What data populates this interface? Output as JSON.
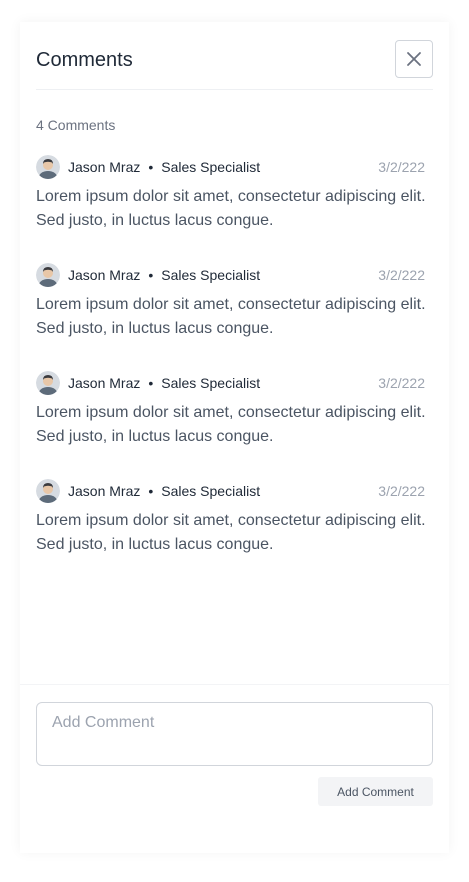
{
  "panel": {
    "title": "Comments",
    "close_icon": "close-icon"
  },
  "comments_count": "4 Comments",
  "comments": [
    {
      "author": "Jason Mraz",
      "separator": "•",
      "role": "Sales Specialist",
      "date": "3/2/222",
      "text": "Lorem ipsum dolor sit amet, consectetur adipiscing elit. Sed justo, in luctus lacus congue."
    },
    {
      "author": "Jason Mraz",
      "separator": "•",
      "role": "Sales Specialist",
      "date": "3/2/222",
      "text": "Lorem ipsum dolor sit amet, consectetur adipiscing elit. Sed justo, in luctus lacus congue."
    },
    {
      "author": "Jason Mraz",
      "separator": "•",
      "role": "Sales Specialist",
      "date": "3/2/222",
      "text": "Lorem ipsum dolor sit amet, consectetur adipiscing elit. Sed justo, in luctus lacus congue."
    },
    {
      "author": "Jason Mraz",
      "separator": "•",
      "role": "Sales Specialist",
      "date": "3/2/222",
      "text": "Lorem ipsum dolor sit amet, consectetur adipiscing elit. Sed justo, in luctus lacus congue."
    }
  ],
  "composer": {
    "placeholder": "Add Comment",
    "value": "",
    "submit_label": "Add Comment"
  },
  "colors": {
    "text_primary": "#1f2937",
    "text_muted": "#6b7280",
    "text_faint": "#9ca3af",
    "border": "#d1d5db",
    "button_bg": "#f3f4f6"
  }
}
